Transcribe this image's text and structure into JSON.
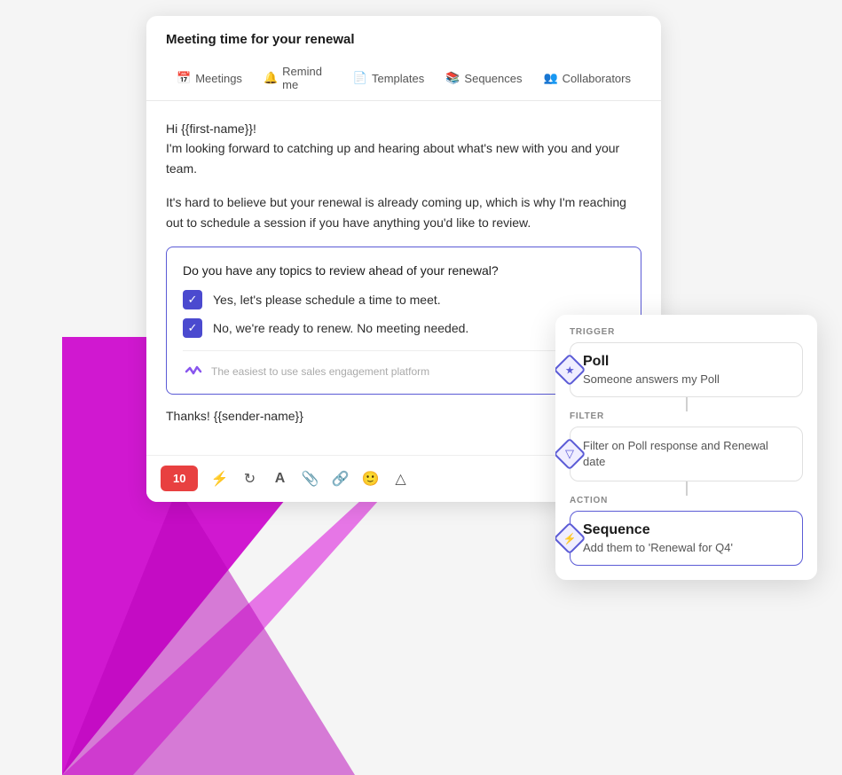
{
  "email": {
    "title": "Meeting time for your renewal",
    "nav": [
      {
        "label": "Meetings",
        "icon": "📅"
      },
      {
        "label": "Remind me",
        "icon": "🔔"
      },
      {
        "label": "Templates",
        "icon": "📄"
      },
      {
        "label": "Sequences",
        "icon": "📚"
      },
      {
        "label": "Collaborators",
        "icon": "👥"
      }
    ],
    "body_line1": "Hi {{first-name}}!",
    "body_line2": "I'm looking forward to catching up and hearing about what's new with you and your team.",
    "body_line3": "It's hard to believe but your renewal is already coming up, which is why I'm reaching out to schedule a session if you have anything you'd like to review.",
    "poll_question": "Do you have any topics to review ahead of your renewal?",
    "poll_options": [
      "Yes, let's please schedule a time to meet.",
      "No, we're ready to renew. No meeting needed."
    ],
    "poll_footer_text": "The easiest to use sales engagement platform",
    "thanks": "Thanks! {{sender-name}}",
    "toolbar_send": "10"
  },
  "automation": {
    "trigger_label": "TRIGGER",
    "trigger_title": "Poll",
    "trigger_desc": "Someone answers my Poll",
    "trigger_icon": "⭐",
    "filter_label": "FILTER",
    "filter_title": "Filter on Poll response and Renewal date",
    "filter_icon": "⬡",
    "action_label": "ACTION",
    "action_title": "Sequence",
    "action_desc": "Add them to 'Renewal for Q4'",
    "action_icon": "⚡"
  },
  "icons": {
    "lightning": "⚡",
    "refresh": "↻",
    "font": "A",
    "paperclip": "📎",
    "link": "🔗",
    "emoji": "😊",
    "shape": "△"
  }
}
